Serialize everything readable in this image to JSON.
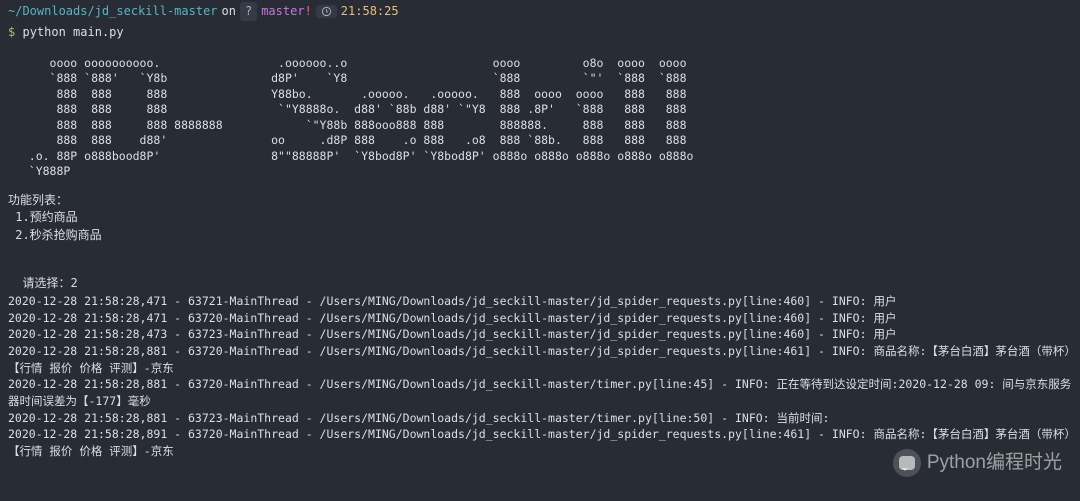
{
  "topbar": {
    "path": "~/Downloads/jd_seckill-master",
    "on_label": "on",
    "branch_icon": "?",
    "branch": "master",
    "dirty": "!",
    "time": "21:58:25"
  },
  "prompt": {
    "symbol": "$",
    "command": "python main.py"
  },
  "ascii_art": "      oooo oooooooooo.                 .oooooo..o                     oooo         o8o  oooo  oooo\n      `888 `888'   `Y8b               d8P'    `Y8                     `888         `\"'  `888  `888\n       888  888     888               Y88bo.       .ooooo.   .ooooo.   888  oooo  oooo   888   888\n       888  888     888                `\"Y8888o.  d88' `88b d88' `\"Y8  888 .8P'   `888   888   888\n       888  888     888 8888888            `\"Y88b 888ooo888 888        888888.     888   888   888\n       888  888    d88'               oo     .d8P 888    .o 888   .o8  888 `88b.   888   888   888\n   .o. 88P o888bood8P'                8\"\"88888P'  `Y8bod8P' `Y8bod8P' o888o o888o o888o o888o o888o\n   `Y888P",
  "menu": {
    "header": "功能列表：",
    "item1": " 1.预约商品",
    "item2": " 2.秒杀抢购商品"
  },
  "select": {
    "prompt": "请选择：",
    "value": "2"
  },
  "logs": {
    "l1": "2020-12-28 21:58:28,471 - 63721-MainThread - /Users/MING/Downloads/jd_seckill-master/jd_spider_requests.py[line:460] - INFO: 用户",
    "l2": "2020-12-28 21:58:28,471 - 63720-MainThread - /Users/MING/Downloads/jd_seckill-master/jd_spider_requests.py[line:460] - INFO: 用户",
    "l3": "2020-12-28 21:58:28,473 - 63723-MainThread - /Users/MING/Downloads/jd_seckill-master/jd_spider_requests.py[line:460] - INFO: 用户",
    "l4": "2020-12-28 21:58:28,881 - 63720-MainThread - /Users/MING/Downloads/jd_seckill-master/jd_spider_requests.py[line:461] - INFO: 商品名称:【茅台白酒】茅台酒（带杯）【行情 报价 价格 评测】-京东",
    "l5": "2020-12-28 21:58:28,881 - 63720-MainThread - /Users/MING/Downloads/jd_seckill-master/timer.py[line:45] - INFO: 正在等待到达设定时间:2020-12-28 09: 间与京东服务器时间误差为【-177】毫秒",
    "l6": "2020-12-28 21:58:28,881 - 63723-MainThread - /Users/MING/Downloads/jd_seckill-master/timer.py[line:50] - INFO: 当前时间:",
    "l7": "2020-12-28 21:58:28,891 - 63720-MainThread - /Users/MING/Downloads/jd_seckill-master/jd_spider_requests.py[line:461] - INFO: 商品名称:【茅台白酒】茅台酒（带杯）【行情 报价 价格 评测】-京东"
  },
  "watermark": {
    "text": "Python编程时光"
  }
}
